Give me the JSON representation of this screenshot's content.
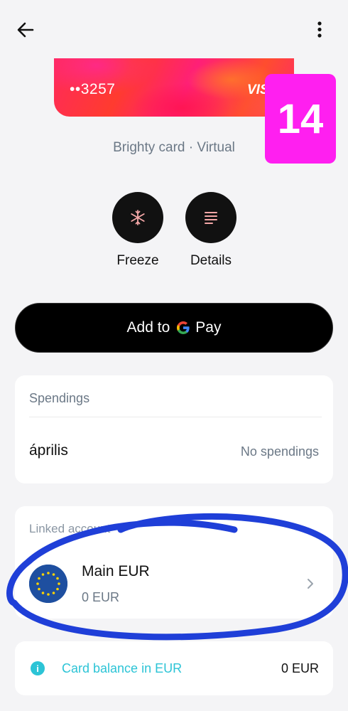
{
  "card": {
    "number": "••3257",
    "brand": "VIS",
    "caption": "Brighty card · Virtual"
  },
  "badge": {
    "text": "14",
    "color": "#ff1ff0"
  },
  "actions": [
    {
      "label": "Freeze",
      "icon": "snowflake-icon"
    },
    {
      "label": "Details",
      "icon": "details-lines-icon"
    }
  ],
  "gpay": {
    "label_prefix": "Add to",
    "label_suffix": "Pay",
    "icon": "google-g-icon"
  },
  "spendings": {
    "title": "Spendings",
    "month": "április",
    "status": "No spendings"
  },
  "linked": {
    "title": "Linked account",
    "account": {
      "name": "Main EUR",
      "balance": "0 EUR",
      "icon": "eu-flag-icon"
    }
  },
  "balance": {
    "label": "Card balance in EUR",
    "value": "0 EUR",
    "icon": "info-icon"
  },
  "colors": {
    "accent": "#2cc4d6",
    "annotation": "#1f3fd8",
    "background": "#f4f4f6"
  }
}
